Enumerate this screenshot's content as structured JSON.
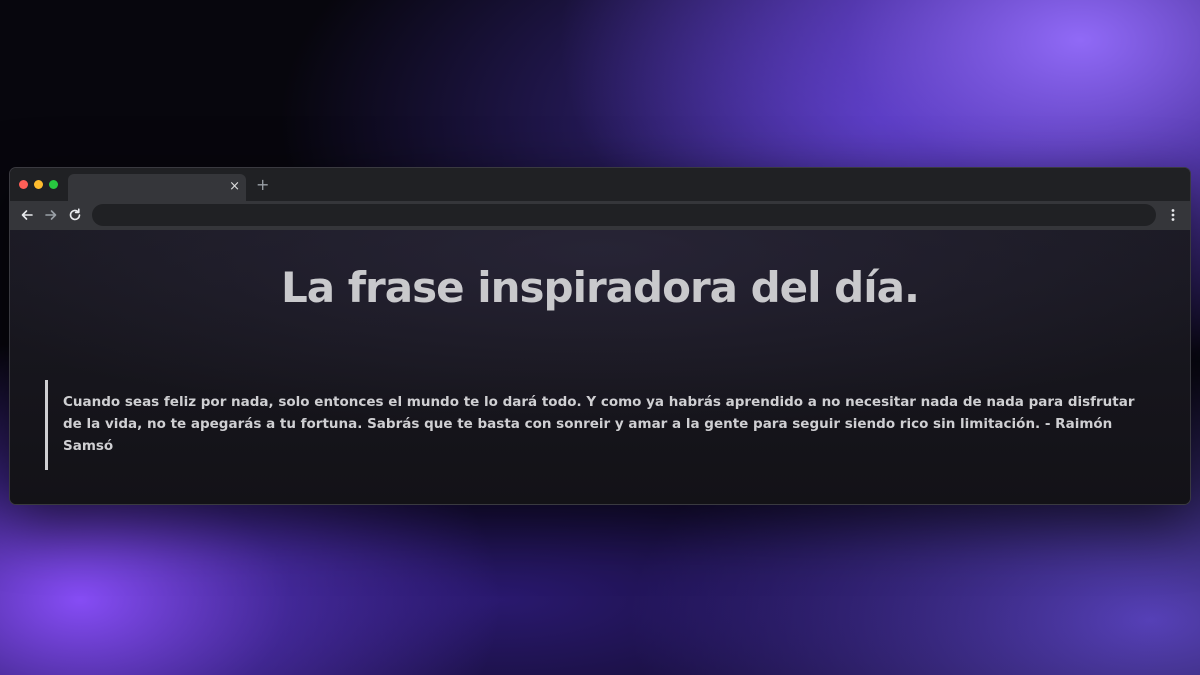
{
  "browser": {
    "tab_close_glyph": "×",
    "new_tab_glyph": "+",
    "address_value": "",
    "icons": {
      "back": "arrow-left-icon",
      "forward": "arrow-right-icon",
      "reload": "reload-icon",
      "menu": "kebab-menu-icon"
    },
    "traffic_light_colors": {
      "close": "#ff5f57",
      "minimize": "#febc2e",
      "maximize": "#28c840"
    }
  },
  "page": {
    "title": "La frase inspiradora del día.",
    "quote": "Cuando seas feliz por nada, solo entonces el mundo te lo dará todo. Y como ya habrás aprendido a no necesitar nada de nada para disfrutar de la vida, no te apegarás a tu fortuna. Sabrás que te basta con sonreir y amar a la gente para seguir siendo rico sin limitación. - Raimón Samsó"
  },
  "colors": {
    "backdrop_accent": "#8b6cff",
    "page_text": "#cfcfd2",
    "window_bg": "#141318"
  }
}
